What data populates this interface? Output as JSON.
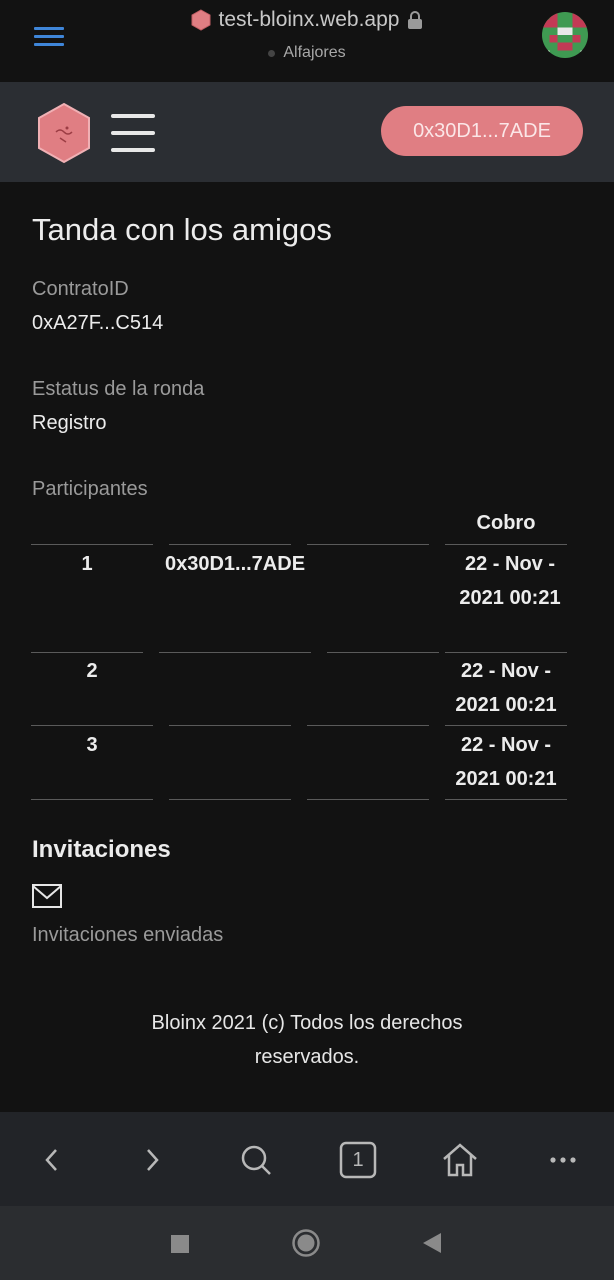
{
  "browser": {
    "url": "test-bloinx.web.app",
    "network": "Alfajores"
  },
  "header": {
    "wallet_address": "0x30D1...7ADE"
  },
  "page": {
    "title": "Tanda con los amigos",
    "contract_label": "ContratoID",
    "contract_value": "0xA27F...C514",
    "status_label": "Estatus de la ronda",
    "status_value": "Registro",
    "participants_label": "Participantes"
  },
  "participants_table": {
    "headers": [
      "",
      "",
      "",
      "Cobro"
    ],
    "rows": [
      {
        "index": "1",
        "address": "0x30D1...7ADE",
        "col3": "",
        "cobro": "22 - Nov - 2021 00:21"
      },
      {
        "index": "2",
        "address": "",
        "col3": "",
        "cobro": "22 - Nov - 2021 00:21"
      },
      {
        "index": "3",
        "address": "",
        "col3": "",
        "cobro": "22 - Nov - 2021 00:21"
      }
    ]
  },
  "invitations": {
    "title": "Invitaciones",
    "sent_label": "Invitaciones enviadas"
  },
  "footer": {
    "text": "Bloinx 2021 (c) Todos los derechos reservados."
  },
  "browser_nav": {
    "tabs_count": "1"
  },
  "colors": {
    "accent": "#e07e83",
    "header_bg": "#2b2e33",
    "background": "#121212",
    "link_blue": "#3f86d9"
  }
}
